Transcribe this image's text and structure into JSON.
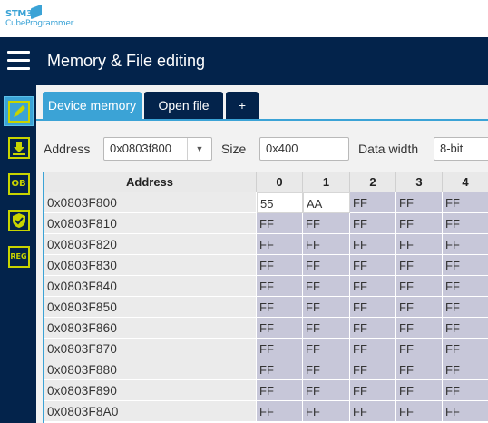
{
  "logo": {
    "line1": "STM32",
    "line2": "CubeProgrammer"
  },
  "header": {
    "title": "Memory & File editing"
  },
  "sidebar": {
    "items": [
      {
        "name": "memory-editing",
        "icon": "pencil-icon",
        "label": ""
      },
      {
        "name": "erase-programming",
        "icon": "download-icon",
        "label": ""
      },
      {
        "name": "option-bytes",
        "icon": "ob-icon",
        "label": "OB"
      },
      {
        "name": "security",
        "icon": "shield-icon",
        "label": ""
      },
      {
        "name": "registers",
        "icon": "reg-icon",
        "label": "REG"
      }
    ]
  },
  "tabs": [
    {
      "label": "Device memory",
      "active": true
    },
    {
      "label": "Open file",
      "active": false
    },
    {
      "label": "+",
      "active": false
    }
  ],
  "controls": {
    "address_label": "Address",
    "address_value": "0x0803f800",
    "size_label": "Size",
    "size_value": "0x400",
    "data_width_label": "Data width",
    "data_width_value": "8-bit"
  },
  "table": {
    "columns": [
      "Address",
      "0",
      "1",
      "2",
      "3",
      "4"
    ],
    "rows": [
      {
        "address": "0x0803F800",
        "values": [
          "55",
          "AA",
          "FF",
          "FF",
          "FF"
        ]
      },
      {
        "address": "0x0803F810",
        "values": [
          "FF",
          "FF",
          "FF",
          "FF",
          "FF"
        ]
      },
      {
        "address": "0x0803F820",
        "values": [
          "FF",
          "FF",
          "FF",
          "FF",
          "FF"
        ]
      },
      {
        "address": "0x0803F830",
        "values": [
          "FF",
          "FF",
          "FF",
          "FF",
          "FF"
        ]
      },
      {
        "address": "0x0803F840",
        "values": [
          "FF",
          "FF",
          "FF",
          "FF",
          "FF"
        ]
      },
      {
        "address": "0x0803F850",
        "values": [
          "FF",
          "FF",
          "FF",
          "FF",
          "FF"
        ]
      },
      {
        "address": "0x0803F860",
        "values": [
          "FF",
          "FF",
          "FF",
          "FF",
          "FF"
        ]
      },
      {
        "address": "0x0803F870",
        "values": [
          "FF",
          "FF",
          "FF",
          "FF",
          "FF"
        ]
      },
      {
        "address": "0x0803F880",
        "values": [
          "FF",
          "FF",
          "FF",
          "FF",
          "FF"
        ]
      },
      {
        "address": "0x0803F890",
        "values": [
          "FF",
          "FF",
          "FF",
          "FF",
          "FF"
        ]
      },
      {
        "address": "0x0803F8A0",
        "values": [
          "FF",
          "FF",
          "FF",
          "FF",
          "FF"
        ]
      }
    ]
  },
  "colors": {
    "navy": "#03234b",
    "accent": "#3ba3d6",
    "icon_green": "#c8d400",
    "cell_bg": "#c7c7d9"
  }
}
